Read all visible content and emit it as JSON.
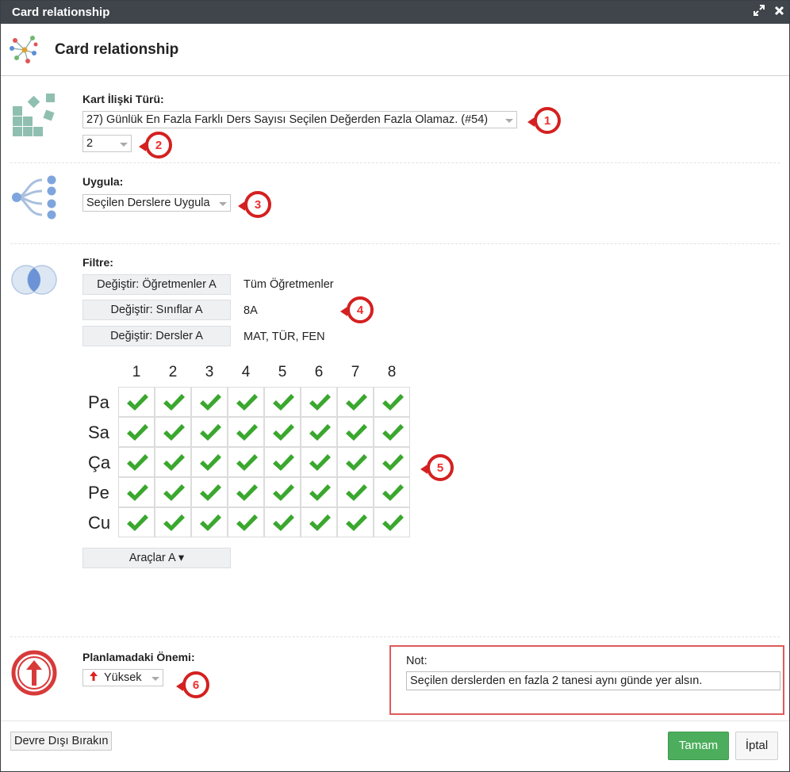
{
  "window": {
    "title": "Card relationship",
    "header_title": "Card relationship"
  },
  "relation_type": {
    "label": "Kart İlişki Türü:",
    "selected": "27) Günlük En Fazla Farklı Ders Sayısı Seçilen Değerden Fazla Olamaz. (#54)",
    "value_selected": "2"
  },
  "apply": {
    "label": "Uygula:",
    "selected": "Seçilen Derslere Uygula"
  },
  "filter": {
    "label": "Filtre:",
    "rows": [
      {
        "button": "Değiştir: Öğretmenler A",
        "value": "Tüm Öğretmenler"
      },
      {
        "button": "Değiştir: Sınıflar A",
        "value": "8A"
      },
      {
        "button": "Değiştir: Dersler A",
        "value": "MAT, TÜR, FEN"
      }
    ]
  },
  "grid": {
    "columns": [
      "1",
      "2",
      "3",
      "4",
      "5",
      "6",
      "7",
      "8"
    ],
    "rows": [
      "Pa",
      "Sa",
      "Ça",
      "Pe",
      "Cu"
    ],
    "checked": [
      [
        true,
        true,
        true,
        true,
        true,
        true,
        true,
        true
      ],
      [
        true,
        true,
        true,
        true,
        true,
        true,
        true,
        true
      ],
      [
        true,
        true,
        true,
        true,
        true,
        true,
        true,
        true
      ],
      [
        true,
        true,
        true,
        true,
        true,
        true,
        true,
        true
      ],
      [
        true,
        true,
        true,
        true,
        true,
        true,
        true,
        true
      ]
    ],
    "check_color": "#3aa72e"
  },
  "tools_button": "Araçlar A ▾",
  "importance": {
    "label": "Planlamadaki Önemi:",
    "selected": "Yüksek",
    "icon_color": "#d83a3a"
  },
  "note": {
    "label": "Not:",
    "value": "Seçilen derslerden en fazla 2 tanesi aynı günde yer alsın."
  },
  "badges": [
    "1",
    "2",
    "3",
    "4",
    "5",
    "6"
  ],
  "footer": {
    "disable_label": "Devre Dışı Bırakın",
    "ok_label": "Tamam",
    "cancel_label": "İptal",
    "ok_color": "#4cae5c"
  }
}
